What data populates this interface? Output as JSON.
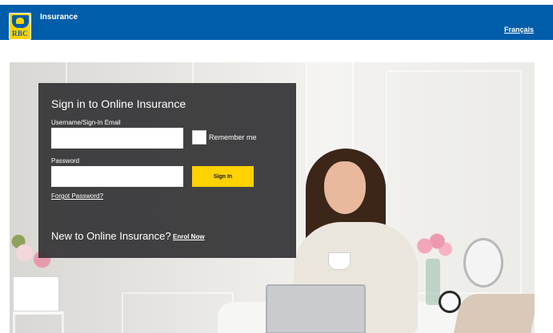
{
  "header": {
    "logo_text": "RBC",
    "title": "Insurance",
    "language_link": "Français"
  },
  "login": {
    "title": "Sign in to Online Insurance",
    "username_label": "Username/Sign-In Email",
    "username_value": "",
    "remember_label": "Remember me",
    "password_label": "Password",
    "password_value": "",
    "signin_label": "Sign In",
    "forgot_label": "Forgot Password?",
    "new_text": "New to Online Insurance?",
    "enrol_label": "Enrol Now"
  },
  "colors": {
    "header_bg": "#005daa",
    "brand_yellow": "#ffd200",
    "panel_bg": "#343436"
  }
}
